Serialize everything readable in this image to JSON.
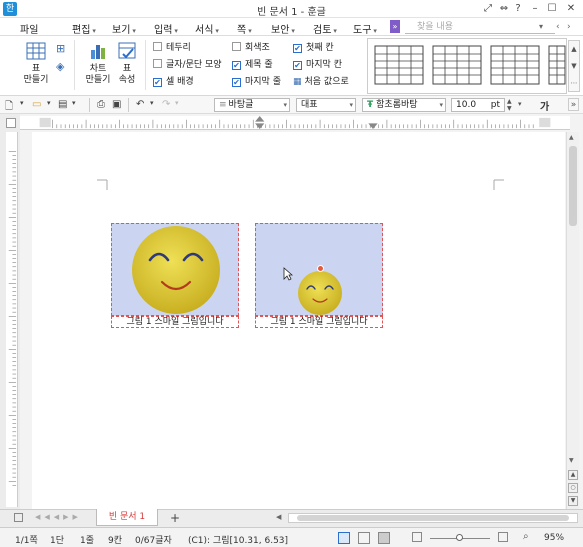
{
  "app": {
    "logo": "한",
    "title": "빈 문서 1 - 훈글"
  },
  "menubar": {
    "items": [
      {
        "label": "파일",
        "dropdown": false
      },
      {
        "label": "편집",
        "dropdown": true
      },
      {
        "label": "보기",
        "dropdown": true
      },
      {
        "label": "입력",
        "dropdown": true
      },
      {
        "label": "서식",
        "dropdown": true
      },
      {
        "label": "쪽",
        "dropdown": true
      },
      {
        "label": "보안",
        "dropdown": true
      },
      {
        "label": "검토",
        "dropdown": true
      },
      {
        "label": "도구",
        "dropdown": true
      }
    ],
    "search_placeholder": "찾을 내용"
  },
  "ribbon": {
    "table_make": "표\n만들기",
    "chart_make": "차트\n만들기",
    "table_props": "표\n속성",
    "checks": [
      {
        "label": "테두리",
        "checked": false
      },
      {
        "label": "글자/문단 모양",
        "checked": false
      },
      {
        "label": "셀 배경",
        "checked": true
      },
      {
        "label": "회색조",
        "checked": false
      },
      {
        "label": "제목 줄",
        "checked": true
      },
      {
        "label": "마지막 줄",
        "checked": true
      },
      {
        "label": "첫째 칸",
        "checked": true
      },
      {
        "label": "마지막 칸",
        "checked": true
      }
    ],
    "reset_label": "처음 값으로"
  },
  "format_toolbar": {
    "style": "바탕글",
    "lang": "대표",
    "font": "함초롬바탕",
    "size": "10.0",
    "unit": "pt",
    "glyph": "가"
  },
  "document": {
    "captions": [
      "그림 1  스마일 그림입니다",
      "그림 1  스마일 그림입니다"
    ]
  },
  "tabs": {
    "doc_tab": "빈 문서 1",
    "add_tab": "+"
  },
  "status": {
    "page": "1/1쪽",
    "section": "1단",
    "line": "1줄",
    "column": "9칸",
    "chars": "0/67글자",
    "position": "(C1): 그림[10.31, 6.53]",
    "zoom": "95%"
  },
  "colors": {
    "cell_bg": "#cbd5f2",
    "smiley": "#e2cc2c",
    "accent": "#1e8fd8",
    "tab_text": "#d63a3a"
  }
}
